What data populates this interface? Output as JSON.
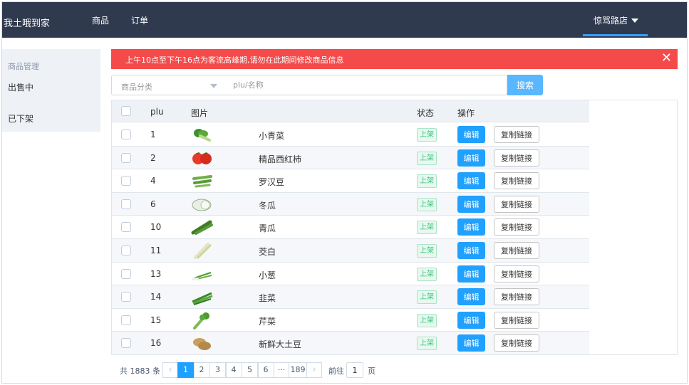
{
  "header": {
    "brand": "我土哦到家",
    "nav": [
      {
        "label": "商品"
      },
      {
        "label": "订单"
      }
    ],
    "store": "惊骂路店"
  },
  "sidebar": {
    "title": "商品管理",
    "items": [
      {
        "label": "出售中"
      },
      {
        "label": "已下架"
      }
    ]
  },
  "alert": {
    "text": "上午10点至下午16点为客流高峰期,请勿在此期间修改商品信息",
    "close": "✕"
  },
  "filter": {
    "category_placeholder": "商品分类",
    "search_placeholder": "plu/名称",
    "search_button": "搜索"
  },
  "table": {
    "columns": {
      "plu": "plu",
      "image": "图片",
      "status": "状态",
      "ops": "操作"
    },
    "edit_label": "编辑",
    "copy_label": "复制链接",
    "rows": [
      {
        "plu": "1",
        "name": "小青菜",
        "status": "上架",
        "icon": "bok-choy-icon"
      },
      {
        "plu": "2",
        "name": "精品西红柿",
        "status": "上架",
        "icon": "tomato-icon"
      },
      {
        "plu": "4",
        "name": "罗汉豆",
        "status": "上架",
        "icon": "beans-icon"
      },
      {
        "plu": "6",
        "name": "冬瓜",
        "status": "上架",
        "icon": "winter-melon-icon"
      },
      {
        "plu": "10",
        "name": "青瓜",
        "status": "上架",
        "icon": "cucumber-icon"
      },
      {
        "plu": "11",
        "name": "茭白",
        "status": "上架",
        "icon": "water-bamboo-icon"
      },
      {
        "plu": "13",
        "name": "小葱",
        "status": "上架",
        "icon": "scallion-icon"
      },
      {
        "plu": "14",
        "name": "韭菜",
        "status": "上架",
        "icon": "chives-icon"
      },
      {
        "plu": "15",
        "name": "芹菜",
        "status": "上架",
        "icon": "celery-icon"
      },
      {
        "plu": "16",
        "name": "新鲜大土豆",
        "status": "上架",
        "icon": "potato-icon"
      }
    ]
  },
  "pagination": {
    "total": "共 1883 条",
    "prev": "‹",
    "pages": [
      "1",
      "2",
      "3",
      "4",
      "5",
      "6"
    ],
    "ellipsis": "···",
    "last": "189",
    "next": "›",
    "goto_prefix": "前往",
    "goto_value": "1",
    "goto_suffix": "页",
    "current": "1"
  },
  "colors": {
    "topbar": "#2f3a4e",
    "accent": "#20a0ff",
    "alert": "#f54a4a",
    "status_green": "#34c27c"
  }
}
